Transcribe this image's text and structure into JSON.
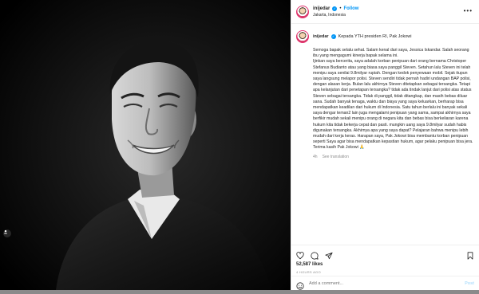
{
  "post": {
    "username": "inijedar",
    "follow_separator": "•",
    "follow_label": "Follow",
    "location": "Jakarta, Indonesia",
    "more_label": "•••"
  },
  "caption": {
    "username": "inijedar",
    "first_line": "Kepada YTH presiden RI, Pak Jokowi",
    "body": "Semoga bapak selalu sehat. Salam kenal dari saya, Jessica Iskandar. Salah seorang ibu yang mengagumi kinerja bapak selama ini.\nIjinkan saya bercerita, saya adalah korban penipuan dari orang bernama Christoper Stefanus Budianto atau yang biasa saya panggil Steven. Setahun lalu Steven ini telah menipu saya senilai 9.8milyar rupiah. Dengan kedok penyewaan mobil. Sejak itupun saya langsung melapor polisi. Steven sendiri tidak pernah hadiri undangan BAP polisi, dengan alasan kerja. Bulan lalu akhirnya Steven ditetapkan sebagai tersangka. Tetapi apa kelanjutan dari penetapan tersangka? tidak ada tindak lanjut dari polisi atas status Steven sebagai tersangka. Tidak di panggil, tidak ditangkap, dan masih bebas diluar sana. Sudah banyak tenaga, waktu dan biaya yang saya keluarkan, berharap bisa mendapatkan keadilan dari hukum di Indonesia. Satu tahun berlalu ini banyak sekali saya dengar teman2 lain juga mengalami penipuan yang sama, sampai akhirnya saya berfikir mudah sekali menipu orang di negara kita dan bebas bisa berkeliaran karena hukum kita tidak bekerja cepat dan pasti. mungkin uang saya 9.8milyar sudah habis digunakan tersangka. Akhirnya apa yang saya dapat? Pelajaran bahwa menipu lebih mudah dari kerja keras. Harapan saya, Pak Jokowi bisa membantu korban penipuan seperti Saya agar bisa mendapatkan kepastian hukum, agar pelaku penipuan bisa jera. Terima kasih Pak Jokowi 🙏",
    "age": "4h",
    "see_translation": "See translation"
  },
  "stats": {
    "likes": "52,587 likes",
    "time_ago": "4 HOURS AGO"
  },
  "comment_box": {
    "placeholder": "Add a comment...",
    "post_label": "Post"
  },
  "icons": {
    "like": "heart-icon",
    "comment": "comment-icon",
    "share": "paper-plane-icon",
    "save": "bookmark-icon",
    "emoji": "emoji-icon",
    "tag": "user-tag-icon"
  }
}
